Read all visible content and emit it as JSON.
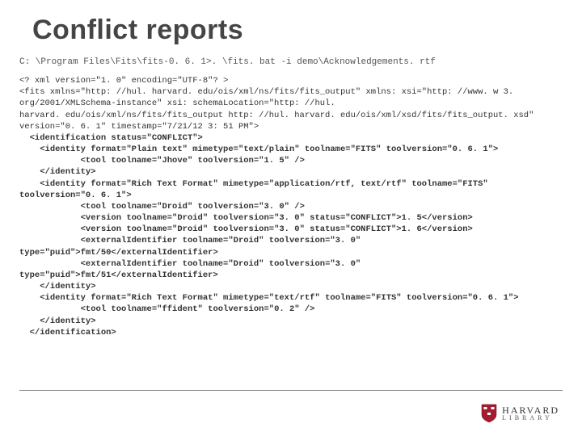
{
  "title": "Conflict reports",
  "command_line": "C: \\Program Files\\Fits\\fits-0. 6. 1>. \\fits. bat -i demo\\Acknowledgements. rtf",
  "xml_header": "<? xml version=\"1. 0\" encoding=\"UTF-8\"? >\n<fits xmlns=\"http: //hul. harvard. edu/ois/xml/ns/fits/fits_output\" xmlns: xsi=\"http: //www. w 3. org/2001/XMLSchema-instance\" xsi: schemaLocation=\"http: //hul.\nharvard. edu/ois/xml/ns/fits/fits_output http: //hul. harvard. edu/ois/xml/xsd/fits/fits_output. xsd\" version=\"0. 6. 1\" timestamp=\"7/21/12 3: 51 PM\">",
  "xml_bold": "  <identification status=\"CONFLICT\">\n    <identity format=\"Plain text\" mimetype=\"text/plain\" toolname=\"FITS\" toolversion=\"0. 6. 1\">\n            <tool toolname=\"Jhove\" toolversion=\"1. 5\" />\n    </identity>\n    <identity format=\"Rich Text Format\" mimetype=\"application/rtf, text/rtf\" toolname=\"FITS\" toolversion=\"0. 6. 1\">\n            <tool toolname=\"Droid\" toolversion=\"3. 0\" />\n            <version toolname=\"Droid\" toolversion=\"3. 0\" status=\"CONFLICT\">1. 5</version>\n            <version toolname=\"Droid\" toolversion=\"3. 0\" status=\"CONFLICT\">1. 6</version>\n            <externalIdentifier toolname=\"Droid\" toolversion=\"3. 0\" type=\"puid\">fmt/50</externalIdentifier>\n            <externalIdentifier toolname=\"Droid\" toolversion=\"3. 0\" type=\"puid\">fmt/51</externalIdentifier>\n    </identity>\n    <identity format=\"Rich Text Format\" mimetype=\"text/rtf\" toolname=\"FITS\" toolversion=\"0. 6. 1\">\n            <tool toolname=\"ffident\" toolversion=\"0. 2\" />\n    </identity>\n  </identification>",
  "logo": {
    "main": "HARVARD",
    "sub": "LIBRARY",
    "shield_color": "#a51c30"
  }
}
